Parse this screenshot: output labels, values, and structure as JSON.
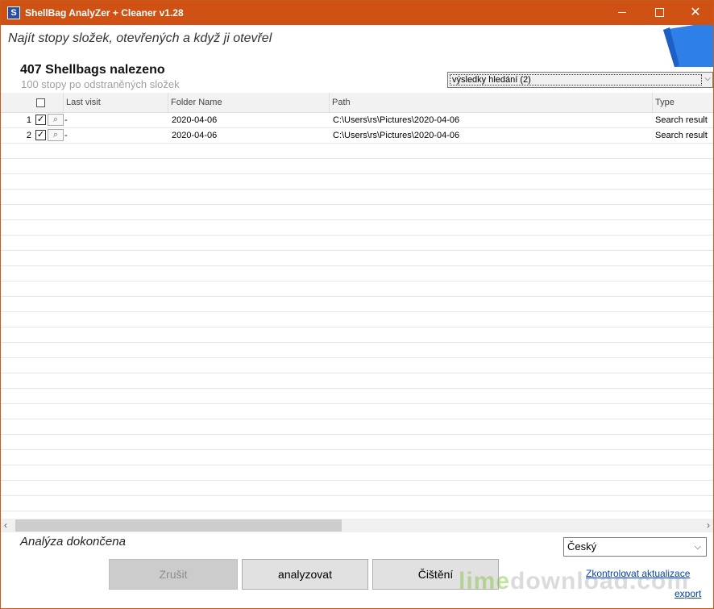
{
  "window": {
    "title": "ShellBag AnalyZer + Cleaner v1.28",
    "icon_letter": "S"
  },
  "header": {
    "subtitle": "Najít stopy složek, otevřených a když ji otevřel",
    "count_title": "407 Shellbags nalezeno",
    "count_sub": "100 stopy po odstraněných složek"
  },
  "filter": {
    "selected": "výsledky hledání  (2)"
  },
  "table": {
    "columns": [
      "Last visit",
      "Folder Name",
      "Path",
      "Type"
    ],
    "rows": [
      {
        "num": "1",
        "checked": "✓",
        "last_visit": "-",
        "folder": "2020-04-06",
        "path": "C:\\Users\\rs\\Pictures\\2020-04-06",
        "type": "Search result"
      },
      {
        "num": "2",
        "checked": "✓",
        "last_visit": "-",
        "folder": "2020-04-06",
        "path": "C:\\Users\\rs\\Pictures\\2020-04-06",
        "type": "Search result"
      }
    ]
  },
  "footer": {
    "status": "Analýza dokončena",
    "language": "Český",
    "cancel_label": "Zrušit",
    "analyze_label": "analyzovat",
    "clean_label": "Čištění",
    "update_link": "Zkontrolovat aktualizace",
    "export_link": "export"
  },
  "watermark": {
    "part1": "lime",
    "part2": "download.com"
  },
  "colors": {
    "titlebar": "#cf5214",
    "accent_blue": "#2f7fe8",
    "link": "#0645ad"
  }
}
